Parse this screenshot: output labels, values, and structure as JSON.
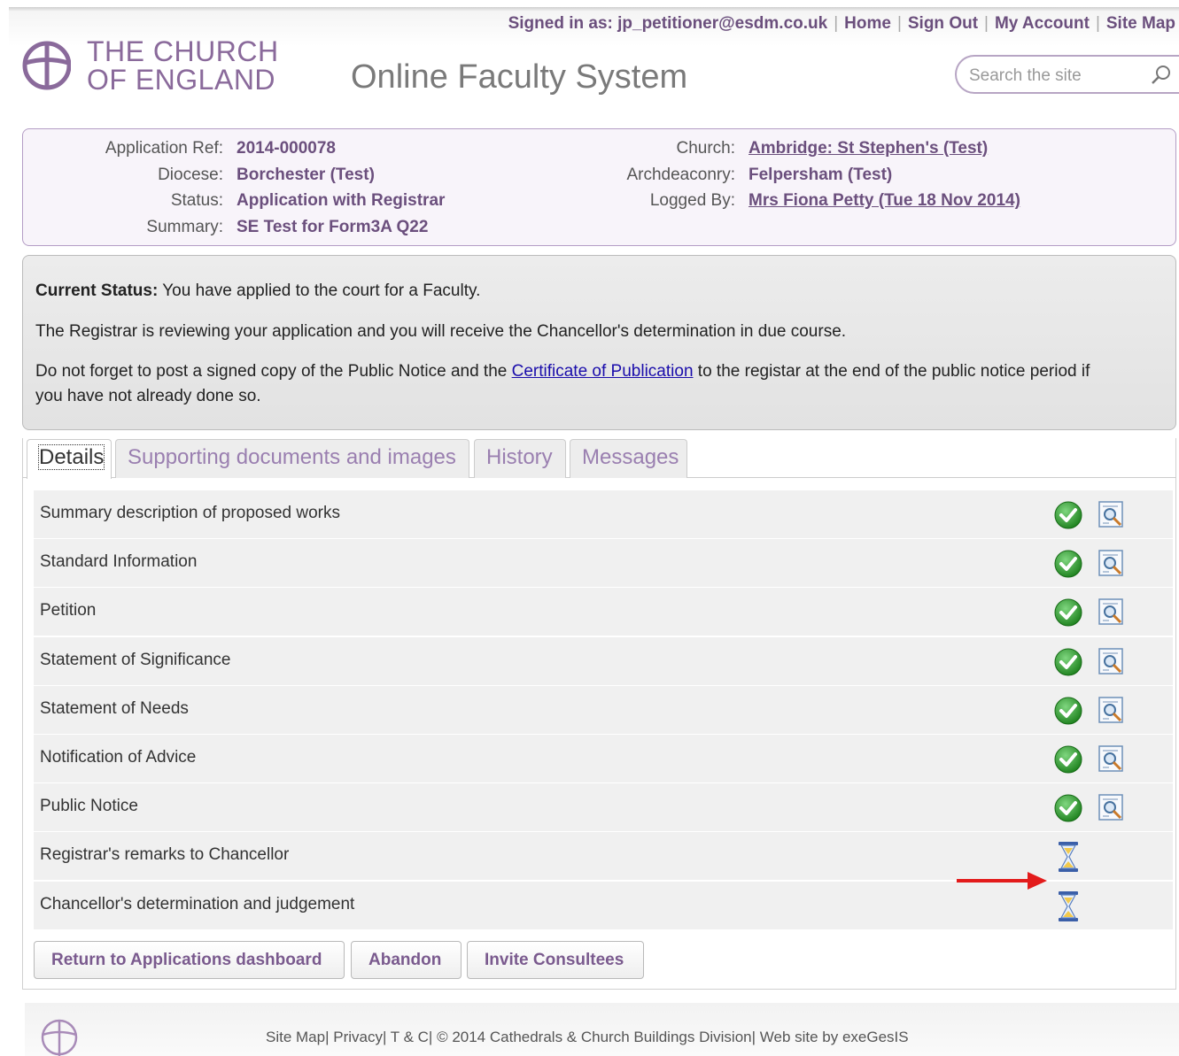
{
  "header": {
    "signed_in": "Signed in as: jp_petitioner@esdm.co.uk",
    "nav": [
      "Home",
      "Sign Out",
      "My Account",
      "Site Map"
    ],
    "logo_line1": "THE CHURCH",
    "logo_line2": "OF ENGLAND",
    "site_title": "Online Faculty System",
    "search_placeholder": "Search the site"
  },
  "info": {
    "left": [
      {
        "label": "Application Ref:",
        "value": "2014-000078"
      },
      {
        "label": "Diocese:",
        "value": "Borchester (Test)"
      },
      {
        "label": "Status:",
        "value": "Application with Registrar"
      },
      {
        "label": "Summary:",
        "value": "SE Test for Form3A Q22"
      }
    ],
    "right": [
      {
        "label": "Church:",
        "value": "Ambridge: St Stephen's (Test)"
      },
      {
        "label": "Archdeaconry:",
        "value": "Felpersham (Test)"
      },
      {
        "label": "Logged By:",
        "value": "Mrs Fiona Petty (Tue 18 Nov 2014)"
      }
    ]
  },
  "status": {
    "label": "Current Status:",
    "line1_rest": " You have applied to the court for a Faculty.",
    "line2": "The Registrar is reviewing your application and you will receive the Chancellor's determination in due course.",
    "line3_pre": "Do not forget to post a signed copy of the Public Notice and the ",
    "line3_link": "Certificate of Publication",
    "line3_post": " to the registar at the end of the public notice period if",
    "line4": "you have not already done so."
  },
  "tabs": [
    "Details",
    "Supporting documents and images",
    "History",
    "Messages"
  ],
  "rows": [
    {
      "label": "Summary description of proposed works",
      "state": "complete"
    },
    {
      "label": "Standard Information",
      "state": "complete"
    },
    {
      "label": "Petition",
      "state": "complete"
    },
    {
      "label": "Statement of Significance",
      "state": "complete"
    },
    {
      "label": "Statement of Needs",
      "state": "complete"
    },
    {
      "label": "Notification of Advice",
      "state": "complete"
    },
    {
      "label": "Public Notice",
      "state": "complete"
    },
    {
      "label": "Registrar's remarks to Chancellor",
      "state": "pending"
    },
    {
      "label": "Chancellor's determination and judgement",
      "state": "pending"
    }
  ],
  "buttons": [
    "Return to Applications dashboard",
    "Abandon",
    "Invite Consultees"
  ],
  "footer": "Site Map| Privacy| T & C| © 2014 Cathedrals & Church Buildings Division| Web site by exeGesIS",
  "colors": {
    "accent": "#6b4f7d",
    "check": "#2e9e2e",
    "annotation_arrow": "#e31b1b"
  }
}
